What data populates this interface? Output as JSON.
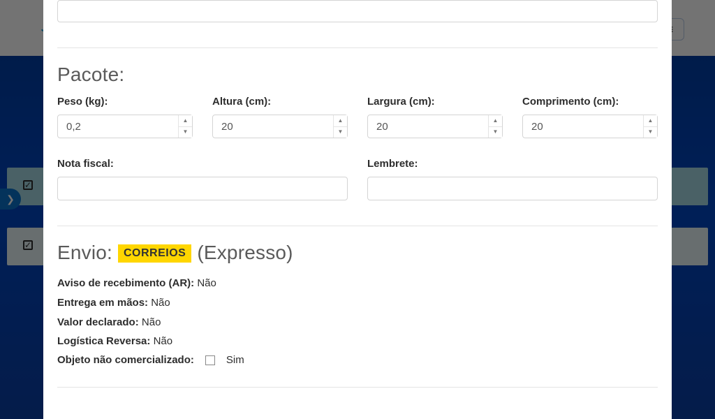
{
  "package": {
    "section_title": "Pacote:",
    "weight": {
      "label": "Peso (kg):",
      "value": "0,2"
    },
    "height": {
      "label": "Altura (cm):",
      "value": "20"
    },
    "width": {
      "label": "Largura (cm):",
      "value": "20"
    },
    "length": {
      "label": "Comprimento (cm):",
      "value": "20"
    },
    "invoice": {
      "label": "Nota fiscal:",
      "value": ""
    },
    "reminder": {
      "label": "Lembrete:",
      "value": ""
    }
  },
  "shipping": {
    "section_prefix": "Envio: ",
    "carrier_badge": "CORREIOS",
    "section_suffix": " (Expresso)",
    "ar": {
      "label": "Aviso de recebimento (AR):",
      "value": "Não"
    },
    "hands": {
      "label": "Entrega em mãos:",
      "value": "Não"
    },
    "declared": {
      "label": "Valor declarado:",
      "value": "Não"
    },
    "reverse": {
      "label": "Logística Reversa:",
      "value": "Não"
    },
    "noncommercial": {
      "label": "Objeto não comercializado:",
      "checkbox_label": "Sim",
      "checked": false
    }
  }
}
